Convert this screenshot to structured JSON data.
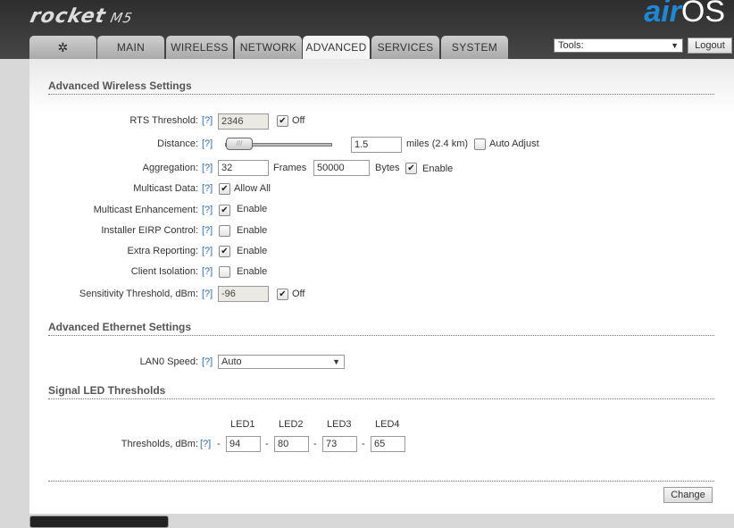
{
  "header": {
    "product": "rocket",
    "model": "M5",
    "brand_air": "air",
    "brand_os": "OS"
  },
  "tabs": [
    {
      "label": ""
    },
    {
      "label": "MAIN"
    },
    {
      "label": "WIRELESS"
    },
    {
      "label": "NETWORK"
    },
    {
      "label": "ADVANCED"
    },
    {
      "label": "SERVICES"
    },
    {
      "label": "SYSTEM"
    }
  ],
  "tools": {
    "selected": "Tools:",
    "logout": "Logout"
  },
  "help": "[?]",
  "wireless": {
    "title": "Advanced Wireless Settings",
    "rts": {
      "label": "RTS Threshold:",
      "value": "2346",
      "check": "Off"
    },
    "distance": {
      "label": "Distance:",
      "value": "1.5",
      "unit": "miles (2.4 km)",
      "auto": "Auto Adjust",
      "slider_fraction": 0.05
    },
    "aggregation": {
      "label": "Aggregation:",
      "frames": "32",
      "frames_unit": "Frames",
      "bytes": "50000",
      "bytes_unit": "Bytes",
      "check": "Enable"
    },
    "multicast": {
      "label": "Multicast Data:",
      "check": "Allow All"
    },
    "mcast_enh": {
      "label": "Multicast Enhancement:",
      "check": "Enable"
    },
    "eirp": {
      "label": "Installer EIRP Control:",
      "check": "Enable"
    },
    "extra": {
      "label": "Extra Reporting:",
      "check": "Enable"
    },
    "isolation": {
      "label": "Client Isolation:",
      "check": "Enable"
    },
    "sensitivity": {
      "label": "Sensitivity Threshold, dBm:",
      "value": "-96",
      "check": "Off"
    }
  },
  "ethernet": {
    "title": "Advanced Ethernet Settings",
    "lan0": {
      "label": "LAN0 Speed:",
      "value": "Auto"
    }
  },
  "led": {
    "title": "Signal LED Thresholds",
    "headers": [
      "LED1",
      "LED2",
      "LED3",
      "LED4"
    ],
    "label": "Thresholds, dBm:",
    "dash": "-",
    "values": [
      "94",
      "80",
      "73",
      "65"
    ]
  },
  "change": "Change"
}
